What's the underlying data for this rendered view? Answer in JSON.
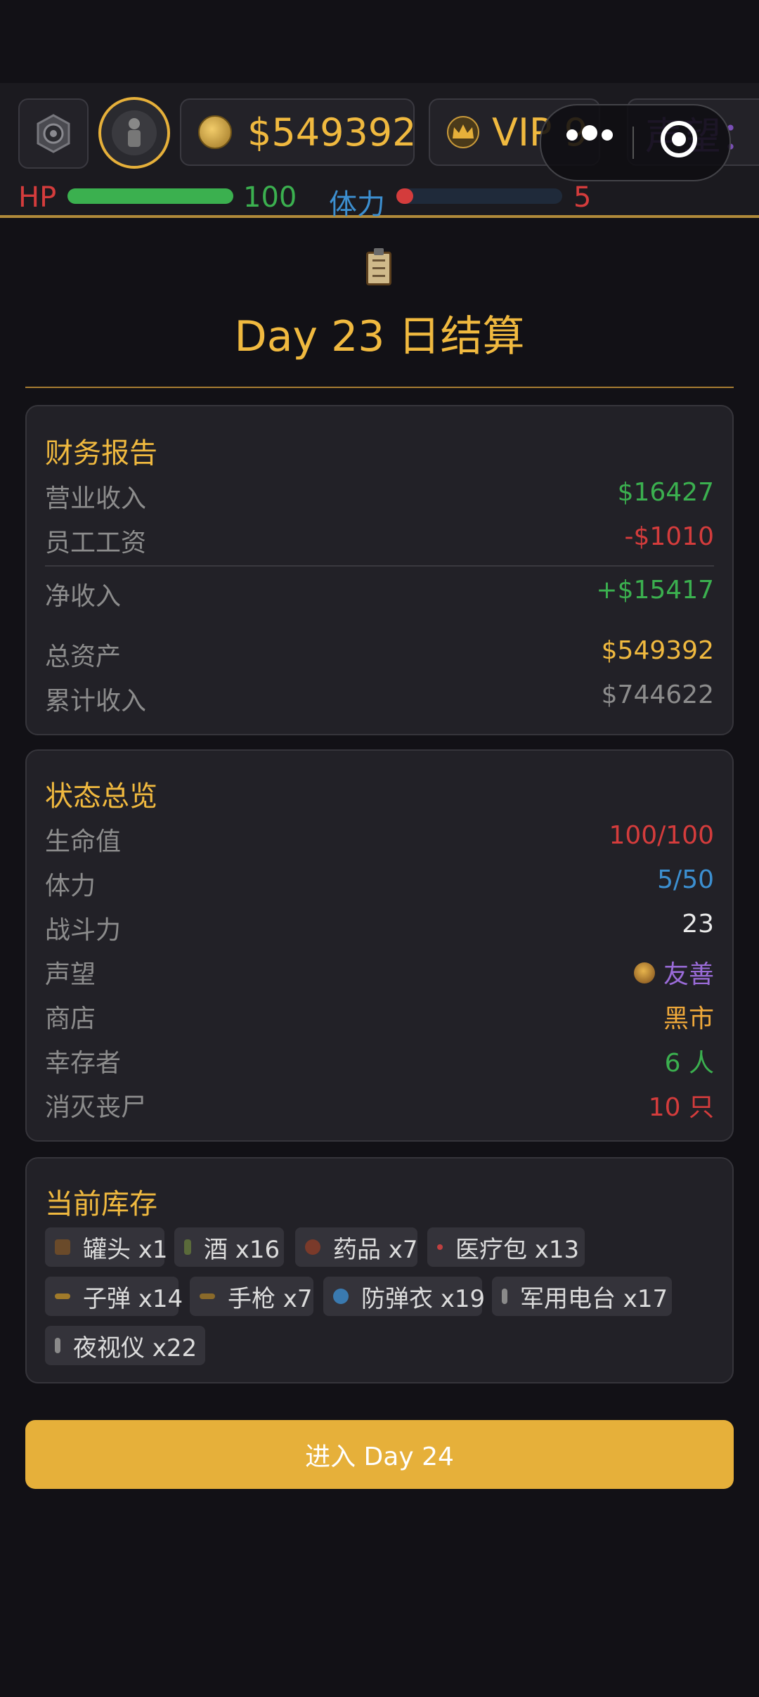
{
  "topbar": {
    "money": "$549392",
    "vip": "VIP 9",
    "reputation_label": "声望：",
    "hp_label": "HP",
    "hp_value": "100",
    "hp_fraction": 1.0,
    "stamina_label": "体力",
    "stamina_value": "5",
    "stamina_fraction": 0.1
  },
  "header": {
    "title": "Day 23 日结算"
  },
  "finance": {
    "title": "财务报告",
    "rows": [
      {
        "label": "营业收入",
        "value": "$16427"
      },
      {
        "label": "员工工资",
        "value": "-$1010"
      },
      {
        "label": "净收入",
        "value": "+$15417"
      },
      {
        "label": "总资产",
        "value": "$549392"
      },
      {
        "label": "累计收入",
        "value": "$744622"
      }
    ]
  },
  "status": {
    "title": "状态总览",
    "rows": [
      {
        "label": "生命值",
        "value": "100/100"
      },
      {
        "label": "体力",
        "value": "5/50"
      },
      {
        "label": "战斗力",
        "value": "23"
      },
      {
        "label": "声望",
        "value": "友善"
      },
      {
        "label": "商店",
        "value": "黑市"
      },
      {
        "label": "幸存者",
        "value": "6 人"
      },
      {
        "label": "消灭丧尸",
        "value": "10 只"
      }
    ]
  },
  "inventory": {
    "title": "当前库存",
    "items": [
      {
        "label": "罐头 x1",
        "icon": "can-icon"
      },
      {
        "label": "酒 x16",
        "icon": "bottle-icon"
      },
      {
        "label": "药品 x7",
        "icon": "medicine-icon"
      },
      {
        "label": "医疗包 x13",
        "icon": "medkit-icon"
      },
      {
        "label": "子弹 x14",
        "icon": "bullet-icon"
      },
      {
        "label": "手枪 x7",
        "icon": "pistol-icon"
      },
      {
        "label": "防弹衣 x19",
        "icon": "vest-icon"
      },
      {
        "label": "军用电台 x17",
        "icon": "radio-icon"
      },
      {
        "label": "夜视仪 x22",
        "icon": "night-vision-icon"
      }
    ]
  },
  "actions": {
    "next_day": "进入 Day 24"
  },
  "colors": {
    "accent": "#f0b93f",
    "positive": "#3bb04f",
    "negative": "#d43c3c",
    "stamina": "#3c8fd0",
    "reputation": "#9a6bd8",
    "button": "#e6b03a"
  }
}
